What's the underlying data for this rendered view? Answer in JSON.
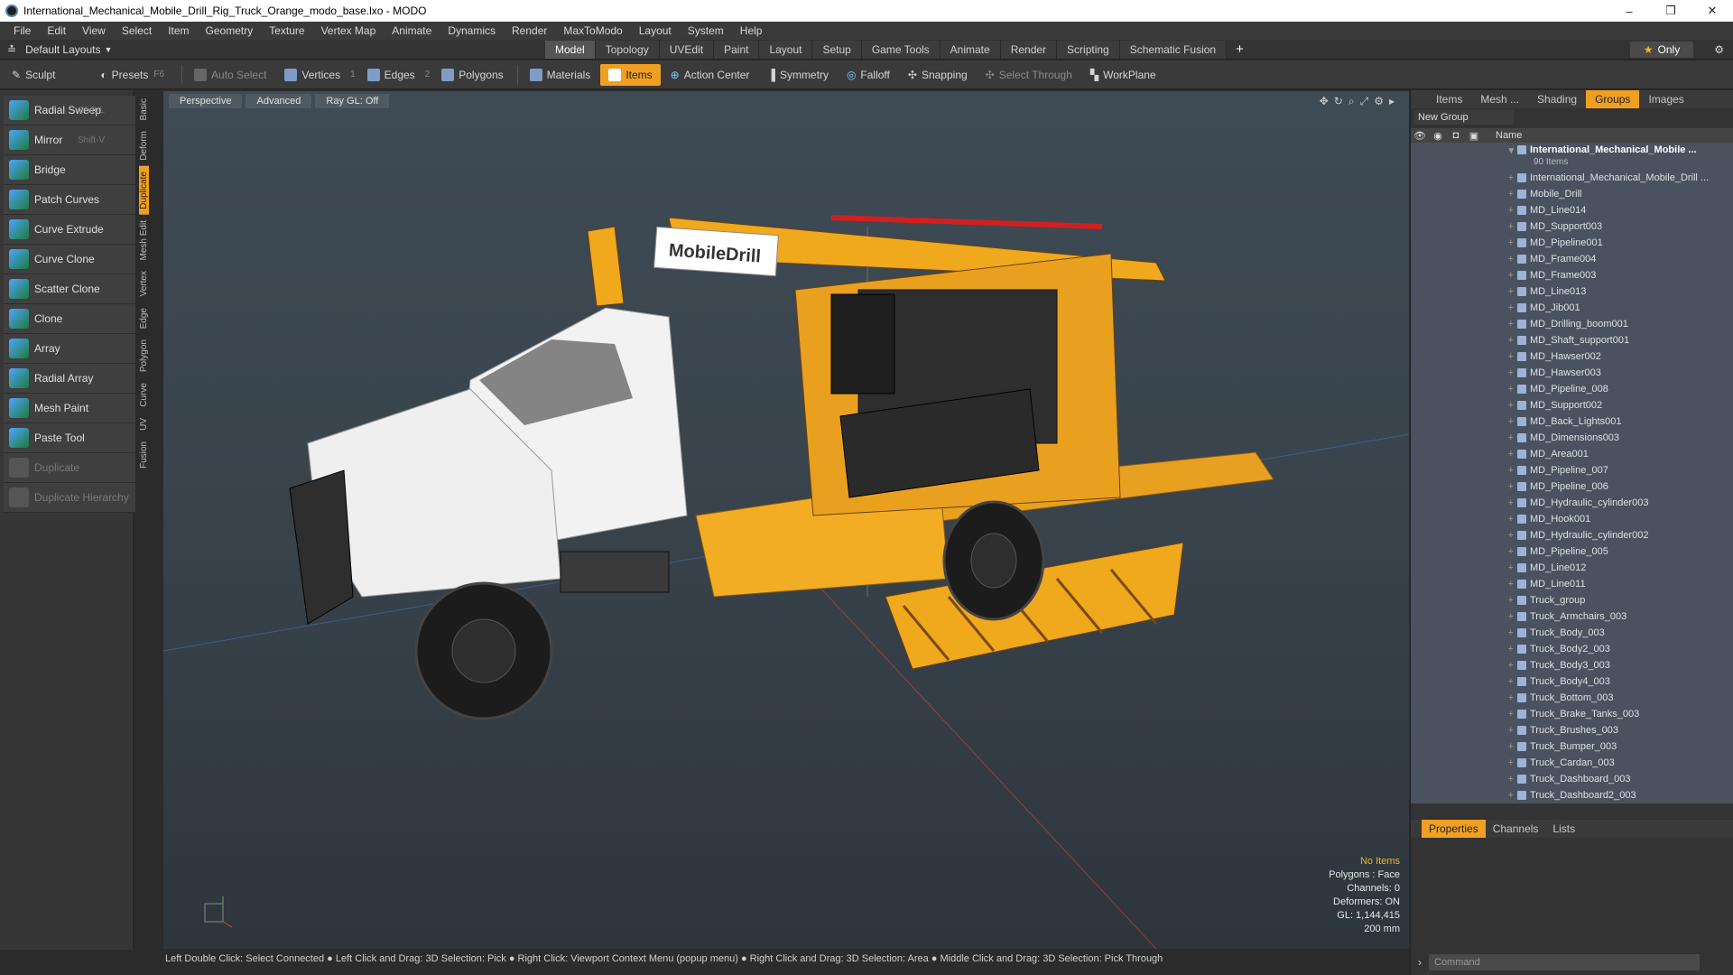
{
  "window": {
    "title": "International_Mechanical_Mobile_Drill_Rig_Truck_Orange_modo_base.lxo - MODO",
    "minimize": "–",
    "maximize": "❐",
    "close": "✕"
  },
  "menu": [
    "File",
    "Edit",
    "View",
    "Select",
    "Item",
    "Geometry",
    "Texture",
    "Vertex Map",
    "Animate",
    "Dynamics",
    "Render",
    "MaxToModo",
    "Layout",
    "System",
    "Help"
  ],
  "layout": {
    "selector": "Default Layouts",
    "tabs": [
      "Model",
      "Topology",
      "UVEdit",
      "Paint",
      "Layout",
      "Setup",
      "Game Tools",
      "Animate",
      "Render",
      "Scripting",
      "Schematic Fusion"
    ],
    "active_tab": "Model",
    "plus": "+",
    "only_label": "Only"
  },
  "toolbar": {
    "sculpt": "Sculpt",
    "presets": "Presets",
    "presets_key": "F6",
    "auto_select": "Auto Select",
    "vertices": "Vertices",
    "vertices_count": "1",
    "edges": "Edges",
    "edges_count": "2",
    "polygons": "Polygons",
    "materials": "Materials",
    "items": "Items",
    "action_center": "Action Center",
    "symmetry": "Symmetry",
    "falloff": "Falloff",
    "snapping": "Snapping",
    "select_through": "Select Through",
    "workplane": "WorkPlane"
  },
  "tools": [
    {
      "label": "Radial Sweep",
      "shortcut": "Shift-L",
      "enabled": true
    },
    {
      "label": "Mirror",
      "shortcut": "Shift-V",
      "enabled": true
    },
    {
      "label": "Bridge",
      "shortcut": "",
      "enabled": true
    },
    {
      "label": "Patch Curves",
      "shortcut": "",
      "enabled": true
    },
    {
      "label": "Curve Extrude",
      "shortcut": "",
      "enabled": true
    },
    {
      "label": "Curve Clone",
      "shortcut": "",
      "enabled": true
    },
    {
      "label": "Scatter Clone",
      "shortcut": "",
      "enabled": true
    },
    {
      "label": "Clone",
      "shortcut": "",
      "enabled": true
    },
    {
      "label": "Array",
      "shortcut": "",
      "enabled": true
    },
    {
      "label": "Radial Array",
      "shortcut": "",
      "enabled": true
    },
    {
      "label": "Mesh Paint",
      "shortcut": "",
      "enabled": true
    },
    {
      "label": "Paste Tool",
      "shortcut": "",
      "enabled": true
    },
    {
      "label": "Duplicate",
      "shortcut": "",
      "enabled": false
    },
    {
      "label": "Duplicate Hierarchy",
      "shortcut": "",
      "enabled": false
    }
  ],
  "vertical_tabs": [
    "Basic",
    "Deform",
    "Duplicate",
    "Mesh Edit",
    "Vertex",
    "Edge",
    "Polygon",
    "Curve",
    "UV",
    "Fusion"
  ],
  "active_vertical_tab": "Duplicate",
  "viewport": {
    "perspective": "Perspective",
    "advanced": "Advanced",
    "raygl": "Ray GL: Off",
    "stats": {
      "no_items": "No Items",
      "polygons": "Polygons : Face",
      "channels": "Channels: 0",
      "deformers": "Deformers: ON",
      "gl": "GL: 1,144,415",
      "scale": "200 mm"
    },
    "logo_text": "MobileDrill"
  },
  "status": "Left Double Click: Select Connected ● Left Click and Drag: 3D Selection: Pick ● Right Click: Viewport Context Menu (popup menu) ● Right Click and Drag: 3D Selection: Area ● Middle Click and Drag: 3D Selection: Pick Through",
  "right_panel": {
    "tabs": [
      "Items",
      "Mesh ...",
      "Shading",
      "Groups",
      "Images"
    ],
    "active_tab": "Groups",
    "new_group": "New Group",
    "name_col": "Name",
    "root": "International_Mechanical_Mobile ...",
    "root_count": "90 Items",
    "items": [
      "International_Mechanical_Mobile_Drill ...",
      "Mobile_Drill",
      "MD_Line014",
      "MD_Support003",
      "MD_Pipeline001",
      "MD_Frame004",
      "MD_Frame003",
      "MD_Line013",
      "MD_Jib001",
      "MD_Drilling_boom001",
      "MD_Shaft_support001",
      "MD_Hawser002",
      "MD_Hawser003",
      "MD_Pipeline_008",
      "MD_Support002",
      "MD_Back_Lights001",
      "MD_Dimensions003",
      "MD_Area001",
      "MD_Pipeline_007",
      "MD_Pipeline_006",
      "MD_Hydraulic_cylinder003",
      "MD_Hook001",
      "MD_Hydraulic_cylinder002",
      "MD_Pipeline_005",
      "MD_Line012",
      "MD_Line011",
      "Truck_group",
      "Truck_Armchairs_003",
      "Truck_Body_003",
      "Truck_Body2_003",
      "Truck_Body3_003",
      "Truck_Body4_003",
      "Truck_Bottom_003",
      "Truck_Brake_Tanks_003",
      "Truck_Brushes_003",
      "Truck_Bumper_003",
      "Truck_Cardan_003",
      "Truck_Dashboard_003",
      "Truck_Dashboard2_003"
    ],
    "props_tabs": [
      "Properties",
      "Channels",
      "Lists"
    ],
    "active_props_tab": "Properties",
    "command_placeholder": "Command"
  },
  "colors": {
    "accent": "#f0a020",
    "truck_orange": "#f0a81c",
    "truck_white": "#f2f2f2"
  }
}
